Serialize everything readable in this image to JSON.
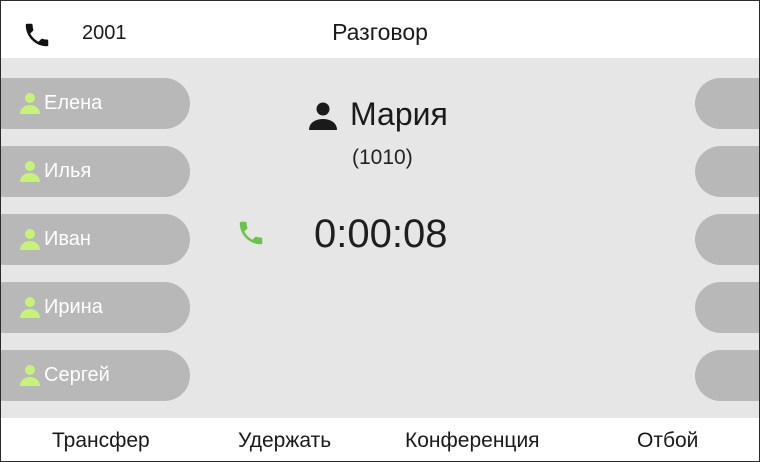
{
  "header": {
    "line_number": "2001",
    "title": "Разговор",
    "line_icon": "phone-icon"
  },
  "contacts": [
    {
      "name": "Елена",
      "icon": "person-icon"
    },
    {
      "name": "Илья",
      "icon": "person-icon"
    },
    {
      "name": "Иван",
      "icon": "person-icon"
    },
    {
      "name": "Ирина",
      "icon": "person-icon"
    },
    {
      "name": "Сергей",
      "icon": "person-icon"
    }
  ],
  "call": {
    "caller_name": "Мария",
    "caller_number": "(1010)",
    "duration": "0:00:08",
    "status_icon": "active-call-icon"
  },
  "softkeys": {
    "transfer": "Трансфер",
    "hold": "Удержать",
    "conference": "Конференция",
    "hangup": "Отбой"
  },
  "colors": {
    "contact_icon": "#c6f27a",
    "call_icon": "#6cc24a",
    "key_background": "#b8b8b8",
    "screen_background": "#e6e6e6"
  }
}
